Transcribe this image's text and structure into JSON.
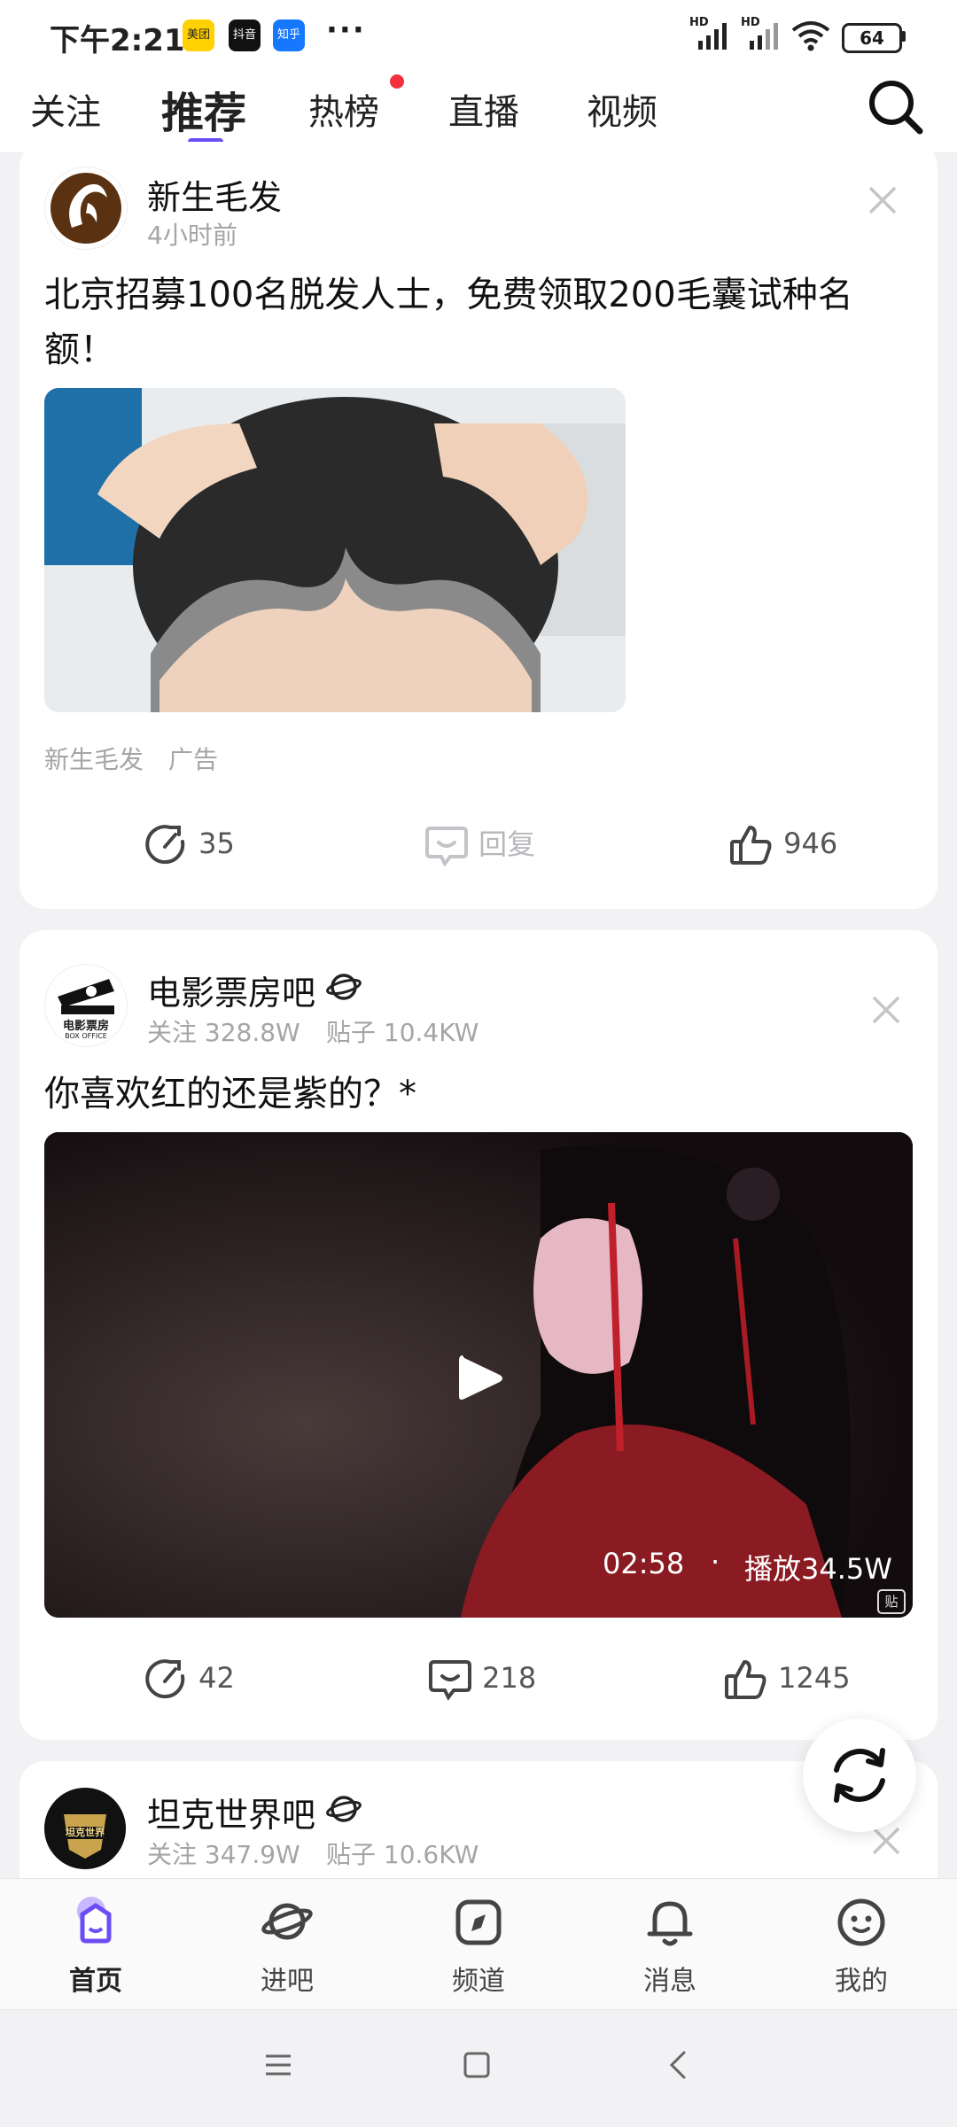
{
  "status_bar": {
    "time": "下午2:21",
    "apps": [
      "美团",
      "抖音",
      "知乎"
    ],
    "more": "···",
    "signal_labels": [
      "HD",
      "HD"
    ],
    "battery": "64"
  },
  "tabs": {
    "items": [
      "关注",
      "推荐",
      "热榜",
      "直播",
      "视频"
    ],
    "active": "推荐"
  },
  "posts": [
    {
      "author": "新生毛发",
      "meta": "4小时前",
      "title": "北京招募100名脱发人士，免费领取200毛囊试种名额！",
      "source": "新生毛发",
      "ad_tag": "广告",
      "share_count": "35",
      "reply_label": "回复",
      "like_count": "946"
    },
    {
      "author": "电影票房吧",
      "avatar_text": "电影票房",
      "avatar_subtext": "BOX OFFICE",
      "meta_follow": "关注 328.8W",
      "meta_posts": "贴子 10.4KW",
      "title": "你喜欢红的还是紫的？*",
      "video_duration": "02:58",
      "video_dot": "·",
      "video_plays": "播放34.5W",
      "video_badge": "贴",
      "share_count": "42",
      "reply_count": "218",
      "like_count": "1245"
    },
    {
      "author": "坦克世界吧",
      "avatar_text": "坦克世界",
      "meta_follow": "关注 347.9W",
      "meta_posts": "贴子 10.6KW"
    }
  ],
  "bottom_nav": {
    "items": [
      "首页",
      "进吧",
      "频道",
      "消息",
      "我的"
    ],
    "active": "首页"
  },
  "colors": {
    "accent": "#6b4cf6",
    "badge_red": "#f5303d",
    "meta_gray": "#a5a5a8"
  }
}
